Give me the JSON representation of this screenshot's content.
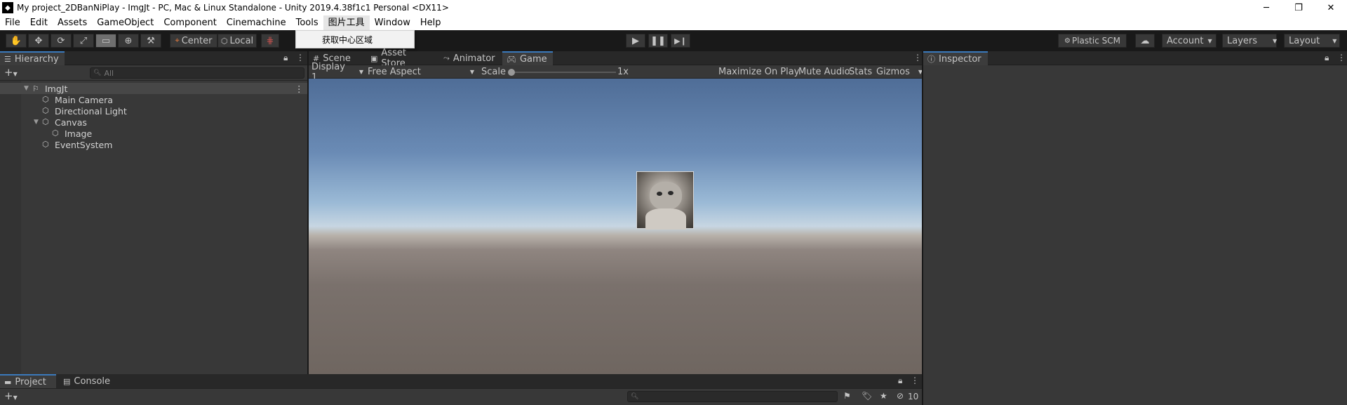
{
  "window": {
    "title": "My project_2DBanNiPlay - ImgJt - PC, Mac & Linux Standalone - Unity 2019.4.38f1c1 Personal <DX11>",
    "logo_icon": "unity-logo-icon",
    "controls": {
      "minimize": "─",
      "restore": "❐",
      "close": "✕"
    }
  },
  "menubar": {
    "items": [
      "File",
      "Edit",
      "Assets",
      "GameObject",
      "Component",
      "Cinemachine",
      "Tools",
      "图片工具",
      "Window",
      "Help"
    ]
  },
  "popup_menu": {
    "items": [
      "获取中心区域"
    ]
  },
  "toolbar": {
    "tools": [
      "hand-icon",
      "move-icon",
      "rotate-icon",
      "scale-icon",
      "rect-tool-icon",
      "transform-icon",
      "custom-tool-icon"
    ],
    "pivot_mode": "Center",
    "pivot_rotation": "Local",
    "play_icons": [
      "play-icon",
      "pause-icon",
      "step-icon"
    ],
    "plastic_scm": "Plastic SCM",
    "account": "Account",
    "layers": "Layers",
    "layout": "Layout"
  },
  "hierarchy": {
    "tab_label": "Hierarchy",
    "search_placeholder": "All",
    "items": [
      {
        "label": "ImgJt",
        "depth": 0,
        "expanded": true
      },
      {
        "label": "Main Camera",
        "depth": 1
      },
      {
        "label": "Directional Light",
        "depth": 1
      },
      {
        "label": "Canvas",
        "depth": 1,
        "expanded": true
      },
      {
        "label": "Image",
        "depth": 2
      },
      {
        "label": "EventSystem",
        "depth": 1
      }
    ]
  },
  "center": {
    "tabs": [
      "Scene",
      "Asset Store",
      "Animator",
      "Game"
    ],
    "active_tab": "Game",
    "display": "Display 1",
    "aspect": "Free Aspect",
    "scale_label": "Scale",
    "scale_value": "1x",
    "maximize_on_play": "Maximize On Play",
    "mute_audio": "Mute Audio",
    "stats": "Stats",
    "gizmos": "Gizmos"
  },
  "inspector": {
    "tab_label": "Inspector"
  },
  "bottom": {
    "tabs": [
      "Project",
      "Console"
    ],
    "hidden_count": "10"
  }
}
